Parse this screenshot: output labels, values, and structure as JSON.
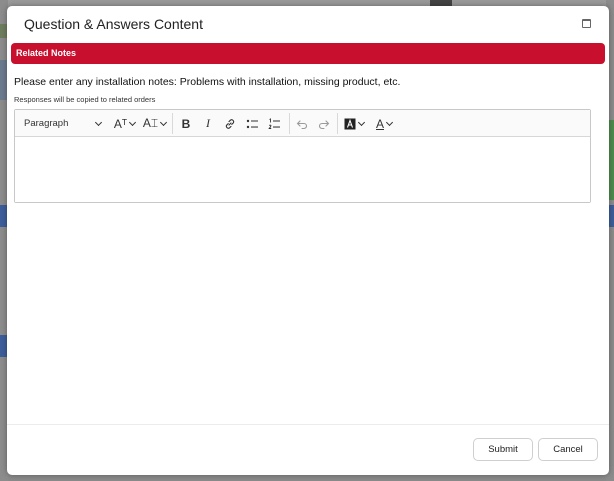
{
  "modal": {
    "title": "Question & Answers Content"
  },
  "section": {
    "label": "Related Notes"
  },
  "form": {
    "instructions": "Please enter any installation notes: Problems with installation, missing product, etc.",
    "hint": "Responses will be copied to related orders",
    "editor_value": ""
  },
  "toolbar": {
    "paragraph_label": "Paragraph",
    "font_size_label": "Aᵀ",
    "font_family_label": "A⌶",
    "bold_label": "B",
    "italic_label": "I",
    "text_color_label": "A",
    "icons": [
      "font-size-icon",
      "font-family-icon",
      "bold-icon",
      "italic-icon",
      "link-icon",
      "bulleted-list-icon",
      "numbered-list-icon",
      "undo-icon",
      "redo-icon",
      "highlight-icon",
      "font-color-icon"
    ]
  },
  "footer": {
    "submit_label": "Submit",
    "cancel_label": "Cancel"
  },
  "colors": {
    "banner": "#c8102e",
    "modal_bg": "#ffffff",
    "overlay": "#8a8a8a"
  }
}
